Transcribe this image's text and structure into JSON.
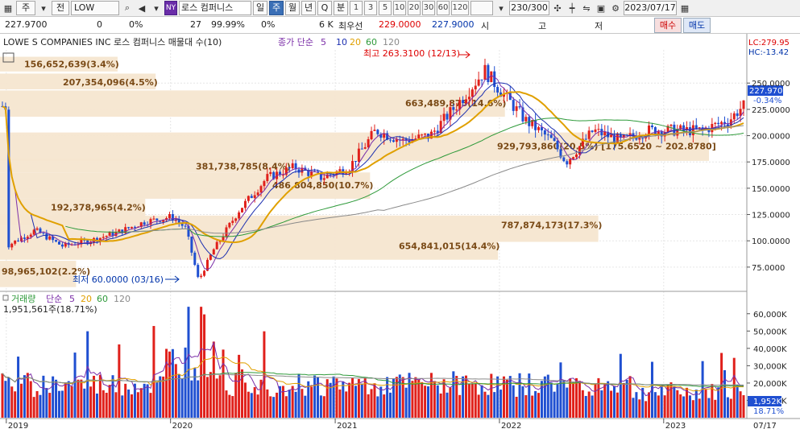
{
  "toolbar": {
    "market": "주",
    "market2": "전",
    "symbol": "LOW",
    "exchange_badge": "NY",
    "stock_name": "로스 컴퍼니스",
    "periods": [
      "일",
      "주",
      "월",
      "년",
      "Q",
      "분",
      "틱"
    ],
    "selected_period": "주",
    "nums": [
      "1",
      "3",
      "5",
      "10",
      "20",
      "30",
      "60",
      "120"
    ],
    "count": "230/300",
    "date": "2023/07/17"
  },
  "infobar": {
    "price": "227.9700",
    "change": "0",
    "change_pct": "0%",
    "volume_ratio": "27",
    "ratio_pct": "99.99%",
    "zero_pct": "0%",
    "vol_k": "6 K",
    "best_ask_label": "최우선",
    "best_ask": "229.0000",
    "best_bid": "227.9000",
    "open_label": "시",
    "high_label": "고",
    "low_label": "저",
    "buy_label": "매수",
    "sell_label": "매도"
  },
  "chart_header": {
    "title": "LOWE S COMPANIES INC  로스 컴퍼니스 매물대 수(10)",
    "ma_label": "종가 단순",
    "ma_periods": [
      "5",
      "10",
      "20",
      "60",
      "120"
    ],
    "lc_label": "LC:279.95",
    "hc_label": "HC:-13.42"
  },
  "price_chart": {
    "high_label": "최고 263.3100 (12/13)",
    "low_label": "최저 60.0000 (03/16)",
    "current_price": "227.9700",
    "current_change": "-0.34%",
    "y_ticks": [
      "250.0000",
      "225.0000",
      "200.0000",
      "175.0000",
      "150.0000",
      "125.0000",
      "100.0000",
      "75.0000"
    ]
  },
  "volume_profile": [
    {
      "label": "156,652,639(3.4%)"
    },
    {
      "label": "207,354,096(4.5%)"
    },
    {
      "label": "663,489,875(14.6%)"
    },
    {
      "label": "929,793,860(20.5%) [175.6520 ~ 202.8780]"
    },
    {
      "label": "381,738,785(8.4%)"
    },
    {
      "label": "486,804,850(10.7%)"
    },
    {
      "label": "192,378,965(4.2%)"
    },
    {
      "label": "787,874,173(17.3%)"
    },
    {
      "label": "654,841,015(14.4%)"
    },
    {
      "label": "98,965,102(2.2%)"
    }
  ],
  "volume_chart": {
    "title": "거래량",
    "ma_label": "단순",
    "ma_periods": [
      "5",
      "20",
      "60",
      "120"
    ],
    "current": "1,951,561주(18.71%)",
    "y_ticks": [
      "60,000K",
      "50,000K",
      "40,000K",
      "30,000K",
      "20,000K",
      "10,000K"
    ],
    "current_value": "1,952K",
    "current_pct": "18.71%"
  },
  "x_axis": {
    "labels": [
      "2019",
      "2020",
      "2021",
      "2022",
      "2023"
    ],
    "end_label": "07/17"
  },
  "colors": {
    "up": "#e0201b",
    "down": "#1f4fd1",
    "ma5": "#7b2ea8",
    "ma10": "#1c2fb0",
    "ma20": "#e0a000",
    "ma60": "#2e9a3a",
    "ma120": "#8a8a8a",
    "profile": "#f5e6d0"
  },
  "chart_data": {
    "type": "candlestick",
    "x_range": [
      "2019-01",
      "2023-07-17"
    ],
    "y_range": [
      55,
      280
    ],
    "high": {
      "value": 263.31,
      "date": "12/13"
    },
    "low": {
      "value": 60.0,
      "date": "03/16"
    },
    "close_series": [
      {
        "x": "2019-01",
        "y": 96
      },
      {
        "x": "2019-03",
        "y": 110
      },
      {
        "x": "2019-05",
        "y": 95
      },
      {
        "x": "2019-07",
        "y": 100
      },
      {
        "x": "2019-09",
        "y": 108
      },
      {
        "x": "2019-11",
        "y": 118
      },
      {
        "x": "2020-01",
        "y": 123
      },
      {
        "x": "2020-02",
        "y": 112
      },
      {
        "x": "2020-03",
        "y": 62
      },
      {
        "x": "2020-04",
        "y": 90
      },
      {
        "x": "2020-06",
        "y": 130
      },
      {
        "x": "2020-08",
        "y": 160
      },
      {
        "x": "2020-10",
        "y": 170
      },
      {
        "x": "2020-12",
        "y": 160
      },
      {
        "x": "2021-02",
        "y": 170
      },
      {
        "x": "2021-04",
        "y": 205
      },
      {
        "x": "2021-06",
        "y": 195
      },
      {
        "x": "2021-08",
        "y": 200
      },
      {
        "x": "2021-10",
        "y": 230
      },
      {
        "x": "2021-12",
        "y": 262
      },
      {
        "x": "2022-01",
        "y": 245
      },
      {
        "x": "2022-03",
        "y": 215
      },
      {
        "x": "2022-05",
        "y": 195
      },
      {
        "x": "2022-06",
        "y": 175
      },
      {
        "x": "2022-08",
        "y": 205
      },
      {
        "x": "2022-10",
        "y": 195
      },
      {
        "x": "2022-12",
        "y": 205
      },
      {
        "x": "2023-02",
        "y": 205
      },
      {
        "x": "2023-04",
        "y": 205
      },
      {
        "x": "2023-06",
        "y": 215
      },
      {
        "x": "2023-07",
        "y": 228
      }
    ],
    "volume_profile_bins": [
      {
        "volume": 156652639,
        "pct": 3.4
      },
      {
        "volume": 207354096,
        "pct": 4.5
      },
      {
        "volume": 663489875,
        "pct": 14.6
      },
      {
        "volume": 929793860,
        "pct": 20.5,
        "range": [
          175.652,
          202.878
        ]
      },
      {
        "volume": 381738785,
        "pct": 8.4
      },
      {
        "volume": 486804850,
        "pct": 10.7
      },
      {
        "volume": 192378965,
        "pct": 4.2
      },
      {
        "volume": 787874173,
        "pct": 17.3
      },
      {
        "volume": 654841015,
        "pct": 14.4
      },
      {
        "volume": 98965102,
        "pct": 2.2
      }
    ],
    "volume_range": [
      0,
      65000
    ]
  }
}
